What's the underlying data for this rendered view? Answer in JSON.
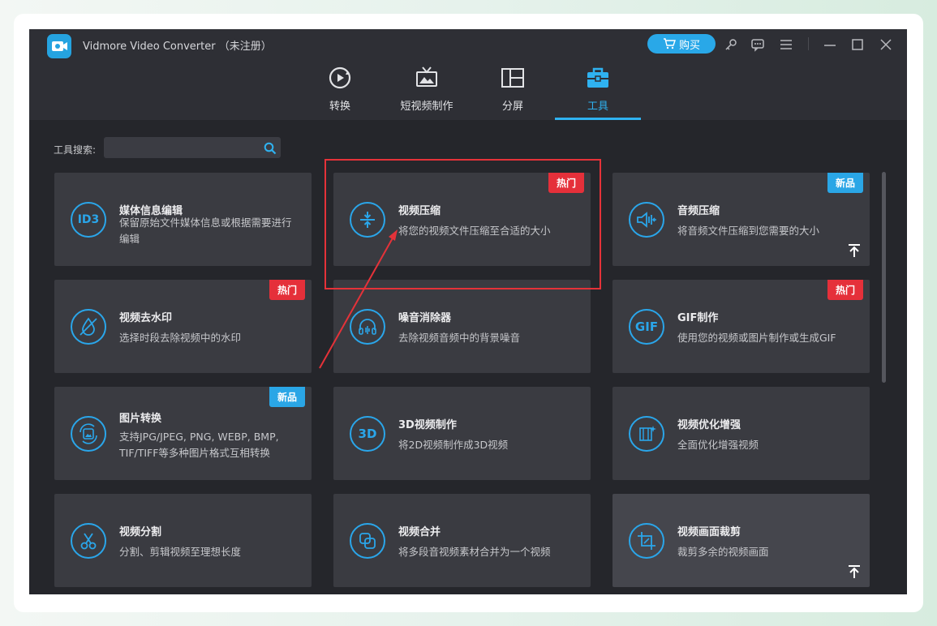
{
  "app": {
    "title": "Vidmore Video Converter （未注册）",
    "buy_label": "购买",
    "accent": "#2fb2f0"
  },
  "titlebar_icons": [
    "key-icon",
    "feedback-icon",
    "menu-icon",
    "minimize-icon",
    "maximize-icon",
    "close-icon"
  ],
  "nav": {
    "tabs": [
      {
        "label": "转换",
        "icon": "convert-icon"
      },
      {
        "label": "短视频制作",
        "icon": "mv-icon"
      },
      {
        "label": "分屏",
        "icon": "collage-icon"
      },
      {
        "label": "工具",
        "icon": "toolbox-icon",
        "active": true
      }
    ]
  },
  "search": {
    "label": "工具搜索:",
    "value": "",
    "placeholder": ""
  },
  "tools": [
    {
      "title": "媒体信息编辑",
      "desc": "保留原始文件媒体信息或根据需要进行编辑",
      "icon_text": "ID3",
      "icon": "id3-icon",
      "badge": ""
    },
    {
      "title": "视频压缩",
      "desc": "将您的视频文件压缩至合适的大小",
      "icon_text": "",
      "icon": "compress-icon",
      "badge": "热门"
    },
    {
      "title": "音频压缩",
      "desc": "将音频文件压缩到您需要的大小",
      "icon_text": "",
      "icon": "audio-compress-icon",
      "badge": "新品"
    },
    {
      "title": "视频去水印",
      "desc": "选择时段去除视频中的水印",
      "icon_text": "",
      "icon": "watermark-remove-icon",
      "badge": "热门"
    },
    {
      "title": "噪音消除器",
      "desc": "去除视频音频中的背景噪音",
      "icon_text": "",
      "icon": "noise-remove-icon",
      "badge": ""
    },
    {
      "title": "GIF制作",
      "desc": "使用您的视频或图片制作或生成GIF",
      "icon_text": "GIF",
      "icon": "gif-icon",
      "badge": "热门"
    },
    {
      "title": "图片转换",
      "desc": "支持JPG/JPEG, PNG, WEBP, BMP, TIF/TIFF等多种图片格式互相转换",
      "icon_text": "",
      "icon": "image-convert-icon",
      "badge": "新品"
    },
    {
      "title": "3D视频制作",
      "desc": "将2D视频制作成3D视频",
      "icon_text": "3D",
      "icon": "3d-icon",
      "badge": ""
    },
    {
      "title": "视频优化增强",
      "desc": "全面优化增强视频",
      "icon_text": "",
      "icon": "enhance-icon",
      "badge": ""
    },
    {
      "title": "视频分割",
      "desc": "分割、剪辑视频至理想长度",
      "icon_text": "",
      "icon": "scissors-icon",
      "badge": ""
    },
    {
      "title": "视频合并",
      "desc": "将多段音视频素材合并为一个视频",
      "icon_text": "",
      "icon": "merge-icon",
      "badge": ""
    },
    {
      "title": "视频画面裁剪",
      "desc": "裁剪多余的视频画面",
      "icon_text": "",
      "icon": "crop-icon",
      "badge": ""
    }
  ],
  "annotation": {
    "color": "#e53239"
  }
}
